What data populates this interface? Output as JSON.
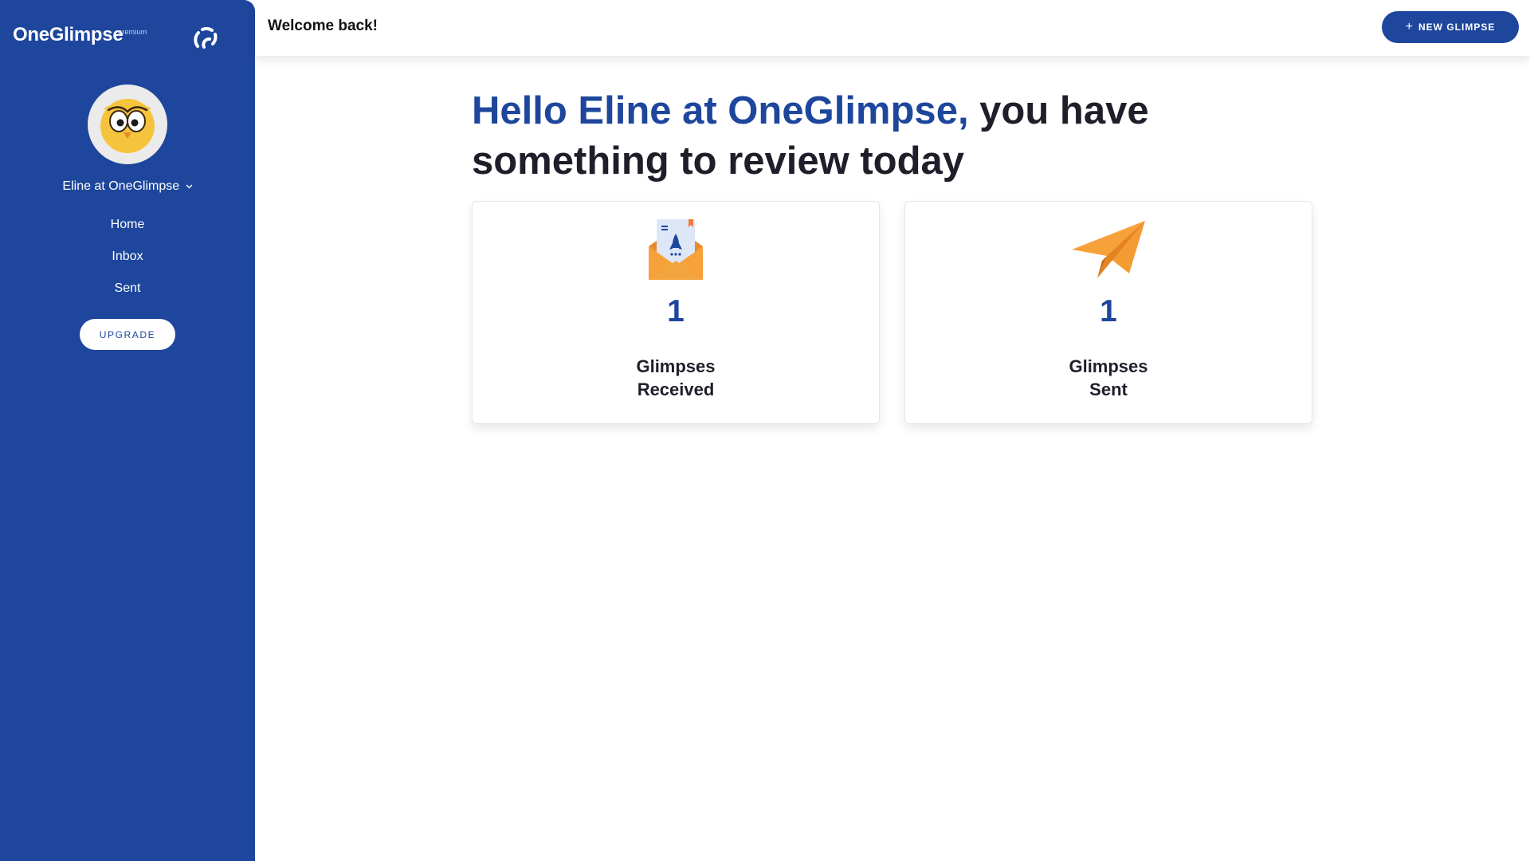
{
  "sidebar": {
    "brand": "OneGlimpse",
    "brand_tag": "premium",
    "user_name": "Eline at OneGlimpse",
    "nav": [
      {
        "label": "Home"
      },
      {
        "label": "Inbox"
      },
      {
        "label": "Sent"
      }
    ],
    "upgrade_label": "UPGRADE"
  },
  "topbar": {
    "title": "Welcome back!",
    "new_button_label": "NEW GLIMPSE"
  },
  "main": {
    "headline_accent": "Hello Eline at OneGlimpse,",
    "headline_rest": " you have something to review today",
    "cards": [
      {
        "count": "1",
        "label_line1": "Glimpses",
        "label_line2": "Received",
        "icon": "envelope-rocket-icon"
      },
      {
        "count": "1",
        "label_line1": "Glimpses",
        "label_line2": "Sent",
        "icon": "paper-plane-icon"
      }
    ]
  },
  "colors": {
    "brand_blue": "#1d469c",
    "accent_orange": "#f7a13a",
    "text_dark": "#1f1f2b"
  }
}
